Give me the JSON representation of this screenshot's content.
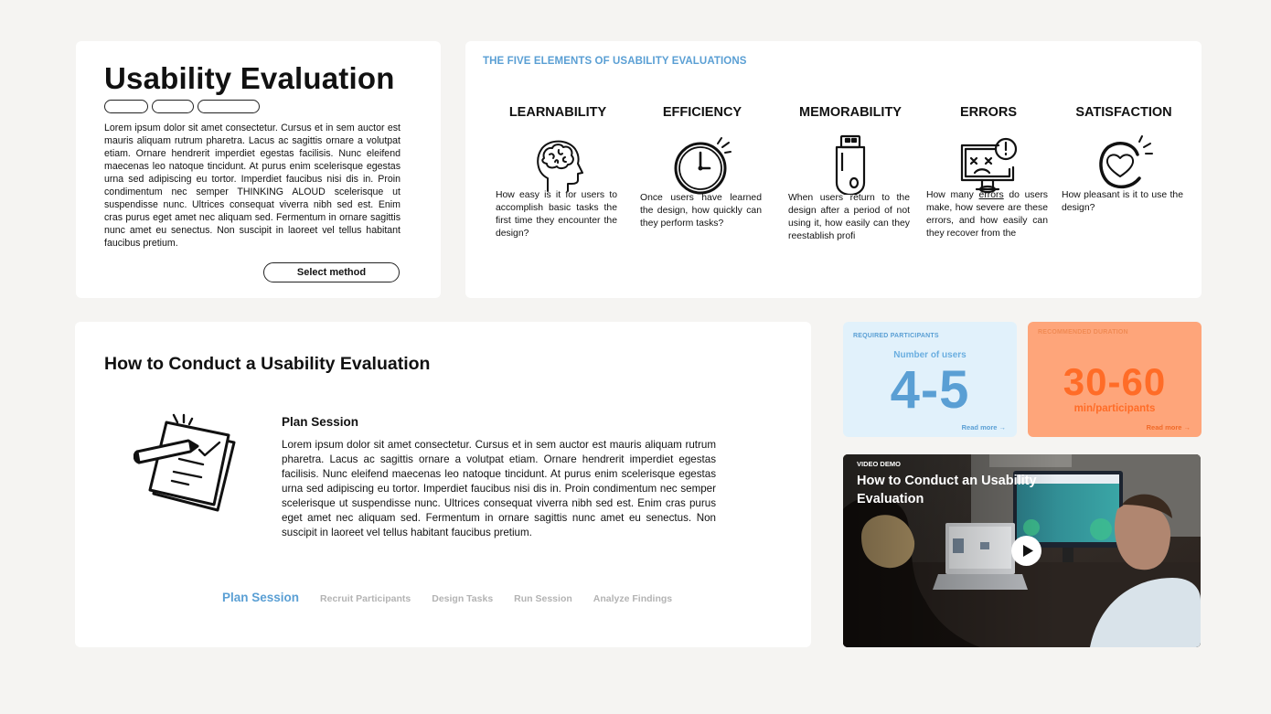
{
  "intro": {
    "title": "Usability Evaluation",
    "body": "Lorem ipsum dolor sit amet consectetur. Cursus et in sem auctor est mauris aliquam rutrum pharetra. Lacus ac sagittis ornare a volutpat etiam. Ornare hendrerit imperdiet egestas facilisis. Nunc eleifend maecenas leo natoque tincidunt. At purus enim scelerisque egestas urna sed adipiscing eu tortor. Imperdiet faucibus nisi dis in. Proin condimentum nec semper THINKING ALOUD scelerisque ut suspendisse nunc. Ultrices consequat viverra nibh sed est. Enim cras purus eget amet nec aliquam sed. Fermentum in ornare sagittis nunc amet eu senectus. Non suscipit in laoreet vel tellus habitant faucibus pretium.",
    "select_label": "Select method"
  },
  "elements": {
    "title": "THE FIVE ELEMENTS OF USABILITY EVALUATIONS",
    "items": [
      {
        "name": "LEARNABILITY",
        "icon": "brain-head-icon",
        "desc": "How easy is it for users to accomplish basic tasks the first time they encounter the design?"
      },
      {
        "name": "EFFICIENCY",
        "icon": "stopwatch-icon",
        "desc": "Once users have learned the design, how quickly can they perform tasks?"
      },
      {
        "name": "MEMORABILITY",
        "icon": "usb-drive-icon",
        "desc": "When users return to the design after a period of not using it, how easily can they reestablish profi"
      },
      {
        "name": "ERRORS",
        "icon": "broken-monitor-icon",
        "desc_before": "How many ",
        "desc_link": "errors",
        "desc_after": " do users make, how severe are these errors, and how easily can they recover from the"
      },
      {
        "name": "SATISFACTION",
        "icon": "heart-bubble-icon",
        "desc": "How pleasant is it to use the design?"
      }
    ]
  },
  "howto": {
    "title": "How to Conduct a Usability Evaluation",
    "plan_title": "Plan Session",
    "plan_body": "Lorem ipsum dolor sit amet consectetur. Cursus et in sem auctor est mauris aliquam rutrum pharetra. Lacus ac sagittis ornare a volutpat etiam. Ornare hendrerit imperdiet egestas facilisis. Nunc eleifend maecenas leo natoque tincidunt. At purus enim scelerisque egestas urna sed adipiscing eu tortor. Imperdiet faucibus nisi dis in. Proin condimentum nec semper scelerisque ut suspendisse nunc. Ultrices consequat viverra nibh sed est. Enim cras purus eget amet nec aliquam sed. Fermentum in ornare sagittis nunc amet eu senectus. Non suscipit in laoreet vel tellus habitant faucibus pretium.",
    "steps": [
      "Plan Session",
      "Recruit Participants",
      "Design Tasks",
      "Run Session",
      "Analyze Findings"
    ],
    "active_step": 0
  },
  "participants": {
    "label": "REQUIRED PARTICIPANTS",
    "sub": "Number of users",
    "value": "4-5",
    "more": "Read more →"
  },
  "duration": {
    "label": "RECOMMENDED DURATION",
    "value": "30-60",
    "sub": "min/participants",
    "more": "Read more →"
  },
  "video": {
    "label": "VIDEO DEMO",
    "title": "How to Conduct an Usability Evaluation"
  },
  "colors": {
    "accent_blue": "#5a9fd4",
    "accent_orange": "#ff6c27",
    "participants_bg": "#e1f1fb",
    "duration_bg": "#fea57a",
    "inactive_step": "#b3b3b3"
  }
}
